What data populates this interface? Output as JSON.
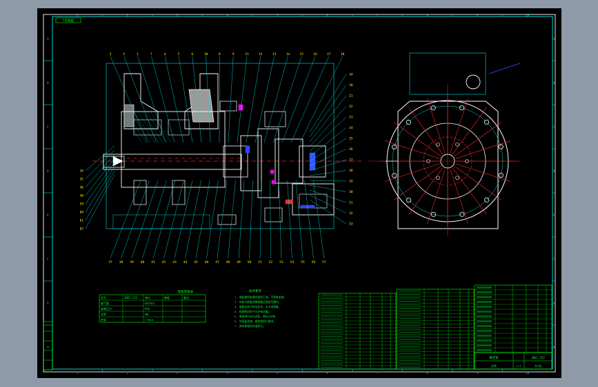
{
  "window": {
    "background": "#8e9aa7",
    "canvas_color": "#000000"
  },
  "colors": {
    "frame": "#ffffff",
    "border": "#00d8d8",
    "lines": "#00e0e0",
    "parts": "#ffffff",
    "section": "#ff2a2a",
    "text": "#00ff00",
    "table_text": "#00ff3c",
    "marker": "#3355ff",
    "accent": "#ff00ff",
    "dim": "#ffff00"
  },
  "drawing": {
    "tag": "7号图纸",
    "zone_numbers_top": [
      "1",
      "2",
      "3",
      "4",
      "5",
      "6",
      "7",
      "8",
      "9",
      "10"
    ],
    "zone_letters_side": [
      "A",
      "B",
      "C",
      "D",
      "E",
      "F",
      "G",
      "H"
    ],
    "balloon_top": [
      "3",
      "2",
      "1",
      "7",
      "4",
      "5",
      "6",
      "10",
      "8",
      "9",
      "11",
      "12",
      "13",
      "14",
      "15",
      "16",
      "17",
      "18"
    ],
    "balloon_right": [
      "19",
      "20",
      "21",
      "22",
      "23",
      "24",
      "25",
      "26",
      "27",
      "28",
      "29",
      "30",
      "31",
      "32",
      "33"
    ],
    "balloon_bottom": [
      "37",
      "38",
      "39",
      "40",
      "41",
      "42",
      "43",
      "44",
      "45",
      "46",
      "47",
      "48",
      "49",
      "50",
      "51",
      "52",
      "53",
      "54",
      "55",
      "56",
      "57"
    ],
    "balloon_left": [
      "34",
      "35",
      "36",
      "58",
      "59",
      "60",
      "61",
      "62"
    ]
  },
  "tables": {
    "performance_title": "性能参数表",
    "performance_rows": [
      [
        "型号",
        "2BE1-253",
        "单位",
        "数值",
        "备注"
      ],
      [
        "抽气量",
        "",
        "m3/min",
        "",
        ""
      ],
      [
        "极限压力",
        "",
        "hPa",
        "",
        ""
      ],
      [
        "功率",
        "",
        "kW",
        "",
        ""
      ],
      [
        "转速",
        "",
        "r/min",
        "",
        ""
      ]
    ],
    "notes_title": "技术要求",
    "notes": [
      "1. 装配前所有零件清洗干净，不得有毛刺。",
      "2. 叶轮与侧盖间隙调整至规定范围内。",
      "3. 装配后转子转动灵活，无卡滞现象。",
      "4. 机械密封处不允许有泄漏。",
      "5. 泵体进行水压试验，保压5分钟。",
      "6. 外表面涂漆，颜色按用户要求。",
      "7. 其余按相关标准执行。"
    ]
  },
  "title_block": {
    "name": "真空泵",
    "drawing_no": "2BE1-253",
    "scale_label": "比例",
    "scale": "1:4",
    "sheet": "共1张"
  }
}
